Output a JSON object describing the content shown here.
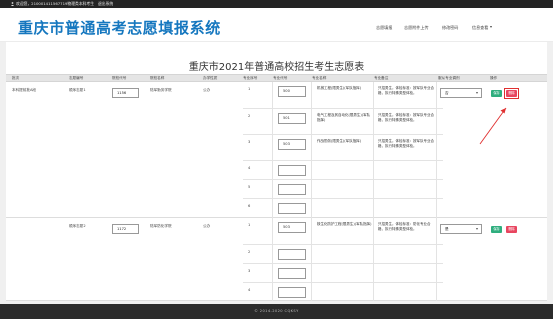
{
  "topbar": {
    "welcome": "欢迎您，210001411567719物理类本科考生",
    "logout": "退出系统"
  },
  "header": {
    "title": "重庆市普通高考志愿填报系统",
    "nav": [
      "志愿填报",
      "志愿附件上传",
      "修改密码",
      "信息查看"
    ],
    "nav_dropdown_index": 3
  },
  "page_title": "重庆市2021年普通高校招生考生志愿表",
  "table": {
    "headers": [
      "批次",
      "志愿编号",
      "院校代号",
      "院校名称",
      "办学性质",
      "专业序号",
      "专业代号",
      "专业名称",
      "专业备注",
      "服从专业调剂",
      "操作"
    ],
    "groups": [
      {
        "batch": "本科提前批A段",
        "volunteer": "顺序志愿1",
        "school_code": "1156",
        "school_name": "陆军勤务学院",
        "nature": "公办",
        "adjust": "否",
        "save_label": "保存",
        "delete_label": "删除",
        "majors": [
          {
            "num": "1",
            "code": "500",
            "name": "机械工程(限男生)(军队指挥)",
            "note": "只招男生。体检标准：按军队专业合格，执行特殊类型体检。"
          },
          {
            "num": "2",
            "code": "501",
            "name": "电气工程及其自动化(限男生)(军队指挥)",
            "note": "只招男生。体检标准：按军队专业合格，执行特殊类型体检。"
          },
          {
            "num": "3",
            "code": "503",
            "name": "作战勤务(限男生)(军队指挥)",
            "note": "只招男生。体检标准：按军队专业合格，执行特殊类型体检。"
          },
          {
            "num": "4",
            "code": "",
            "name": "",
            "note": ""
          },
          {
            "num": "5",
            "code": "",
            "name": "",
            "note": ""
          },
          {
            "num": "6",
            "code": "",
            "name": "",
            "note": ""
          }
        ]
      },
      {
        "batch": "",
        "volunteer": "顺序志愿2",
        "school_code": "1172",
        "school_name": "陆军防化学院",
        "nature": "公办",
        "adjust": "是",
        "save_label": "保存",
        "delete_label": "删除",
        "majors": [
          {
            "num": "1",
            "code": "503",
            "name": "核生化防护工程(限男生)(军队指挥)",
            "note": "只招男生。体检标准：防化专业合格，执行特殊类型体检。"
          },
          {
            "num": "2",
            "code": "",
            "name": "",
            "note": ""
          },
          {
            "num": "3",
            "code": "",
            "name": "",
            "note": ""
          },
          {
            "num": "4",
            "code": "",
            "name": "",
            "note": ""
          }
        ]
      }
    ]
  },
  "footer": "© 2014-2020 CQKSY",
  "colors": {
    "brand": "#1577bf",
    "save": "#2fae7e",
    "delete": "#e8455f",
    "highlight": "#e03030"
  }
}
